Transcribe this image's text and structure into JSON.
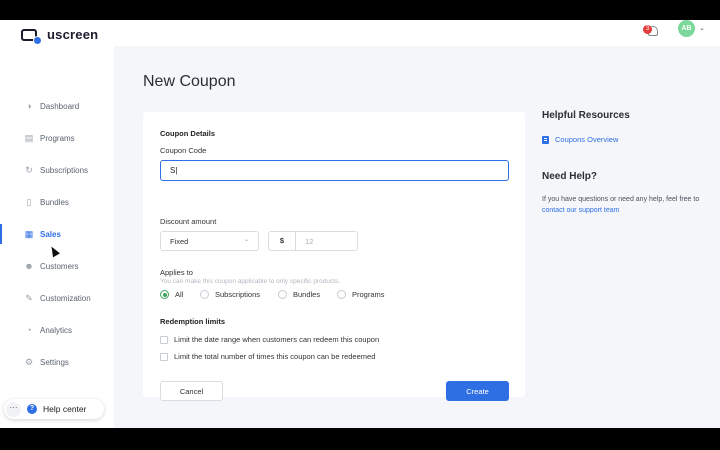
{
  "header": {
    "logo_text": "uscreen",
    "notification_count": "3",
    "avatar_initials": "AB"
  },
  "sidebar": {
    "items": [
      {
        "label": "Dashboard",
        "icon": "dashboard-icon",
        "active": false
      },
      {
        "label": "Programs",
        "icon": "programs-icon",
        "active": false
      },
      {
        "label": "Subscriptions",
        "icon": "subscriptions-icon",
        "active": false
      },
      {
        "label": "Bundles",
        "icon": "bundles-icon",
        "active": false
      },
      {
        "label": "Sales",
        "icon": "sales-icon",
        "active": true
      },
      {
        "label": "Customers",
        "icon": "customers-icon",
        "active": false
      },
      {
        "label": "Customization",
        "icon": "customization-icon",
        "active": false
      },
      {
        "label": "Analytics",
        "icon": "analytics-icon",
        "active": false
      },
      {
        "label": "Settings",
        "icon": "settings-icon",
        "active": false
      }
    ],
    "help_center_label": "Help center",
    "help_more": "···",
    "help_icon": "?"
  },
  "page": {
    "title": "New Coupon"
  },
  "form": {
    "section_title": "Coupon Details",
    "code_label": "Coupon Code",
    "code_value": "S|",
    "discount_label": "Discount amount",
    "discount_type": "Fixed",
    "currency_symbol": "$",
    "amount_placeholder": "12",
    "applies_label": "Applies to",
    "applies_hint": "You can make this coupon applicable to only specific products.",
    "applies_options": [
      {
        "label": "All",
        "selected": true
      },
      {
        "label": "Subscriptions",
        "selected": false
      },
      {
        "label": "Bundles",
        "selected": false
      },
      {
        "label": "Programs",
        "selected": false
      }
    ],
    "redemption_title": "Redemption limits",
    "limit_date_label": "Limit the date range when customers can redeem this coupon",
    "limit_count_label": "Limit the total number of times this coupon can be redeemed",
    "cancel_label": "Cancel",
    "create_label": "Create"
  },
  "resources": {
    "title": "Helpful Resources",
    "link_label": "Coupons Overview",
    "help_title": "Need Help?",
    "help_text_prefix": "If you have questions or need any help, feel free to ",
    "help_link": "contact our support team"
  },
  "colors": {
    "accent": "#2f6fe4",
    "selected_radio": "#3ba55c",
    "notification_badge": "#e23c3c",
    "avatar": "#7bd89a"
  }
}
